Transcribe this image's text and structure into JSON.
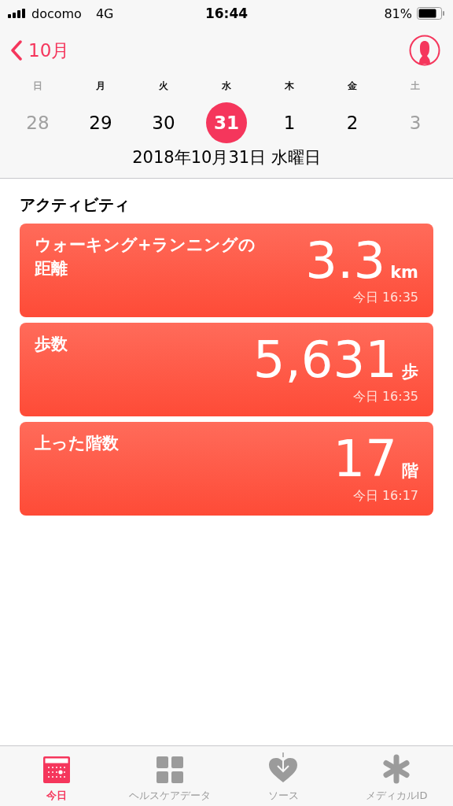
{
  "status_bar": {
    "carrier": "docomo",
    "network": "4G",
    "time": "16:44",
    "battery": "81%"
  },
  "nav": {
    "back": "10月"
  },
  "week": [
    {
      "weekday": "日",
      "day": "28",
      "dimmed": true,
      "selected": false
    },
    {
      "weekday": "月",
      "day": "29",
      "dimmed": false,
      "selected": false
    },
    {
      "weekday": "火",
      "day": "30",
      "dimmed": false,
      "selected": false
    },
    {
      "weekday": "水",
      "day": "31",
      "dimmed": false,
      "selected": true
    },
    {
      "weekday": "木",
      "day": "1",
      "dimmed": false,
      "selected": false
    },
    {
      "weekday": "金",
      "day": "2",
      "dimmed": false,
      "selected": false
    },
    {
      "weekday": "土",
      "day": "3",
      "dimmed": true,
      "selected": false
    }
  ],
  "date_title": "2018年10月31日 水曜日",
  "section_title": "アクティビティ",
  "cards": [
    {
      "title": "ウォーキング+ランニングの距離",
      "value": "3.3",
      "unit": "km",
      "time": "今日 16:35"
    },
    {
      "title": "歩数",
      "value": "5,631",
      "unit": "歩",
      "time": "今日 16:35"
    },
    {
      "title": "上った階数",
      "value": "17",
      "unit": "階",
      "time": "今日 16:17"
    }
  ],
  "tabs": [
    {
      "kind": "today",
      "label": "今日",
      "selected": true
    },
    {
      "kind": "data",
      "label": "ヘルスケアデータ",
      "selected": false
    },
    {
      "kind": "sources",
      "label": "ソース",
      "selected": false
    },
    {
      "kind": "medical",
      "label": "メディカルID",
      "selected": false
    }
  ]
}
